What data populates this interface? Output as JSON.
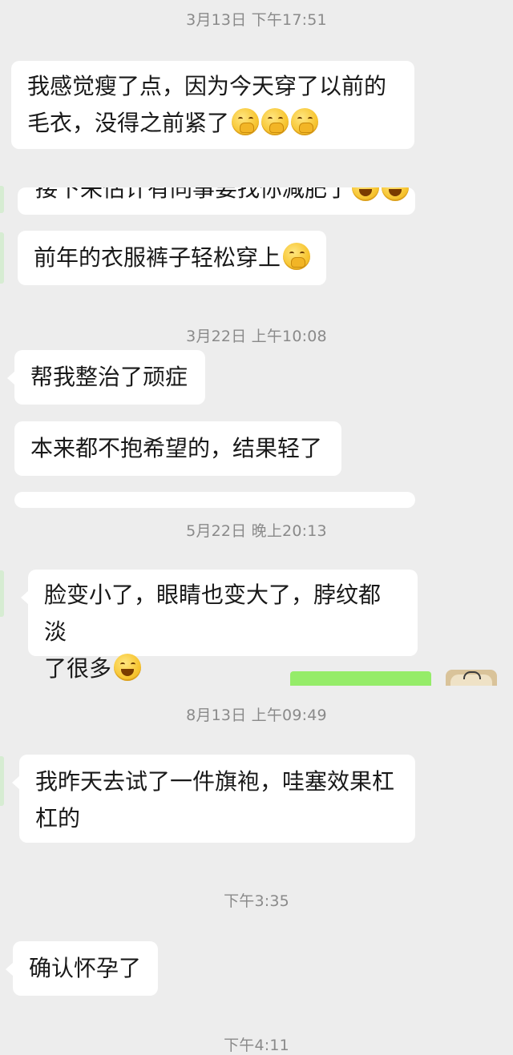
{
  "timestamps": {
    "t1": "3月13日 下午17:51",
    "t2": "3月22日 上午10:08",
    "t3": "5月22日 晚上20:13",
    "t4": "8月13日 上午09:49",
    "t5": "下午3:35",
    "t6": "下午4:11"
  },
  "messages": {
    "m1_line1": "我感觉瘦了点，因为今天穿了以前的",
    "m1_line2": "毛衣，没得之前紧了",
    "m2_partial": "接下来估计有同事要找你减肥了",
    "m3": "前年的衣服裤子轻松穿上",
    "m4": "帮我整治了顽症",
    "m5": "本来都不抱希望的，结果轻了",
    "m6_line1": "脸变小了，眼睛也变大了，脖纹都淡",
    "m6_line2": "了很多",
    "m7_line1": "我昨天去试了一件旗袍，哇塞效果杠",
    "m7_line2": "杠的",
    "m8": "确认怀孕了"
  },
  "emojis": {
    "m1": [
      "hand-over-mouth-emoji",
      "hand-over-mouth-emoji",
      "hand-over-mouth-emoji"
    ],
    "m2": [
      "laughing-tears-emoji",
      "laughing-tears-emoji"
    ],
    "m3": [
      "hand-over-mouth-emoji"
    ],
    "m6": [
      "laughing-tears-emoji"
    ]
  },
  "colors": {
    "background": "#ededed",
    "bubble_incoming": "#ffffff",
    "bubble_outgoing": "#95ec69",
    "timestamp_text": "#8a8a8a"
  }
}
